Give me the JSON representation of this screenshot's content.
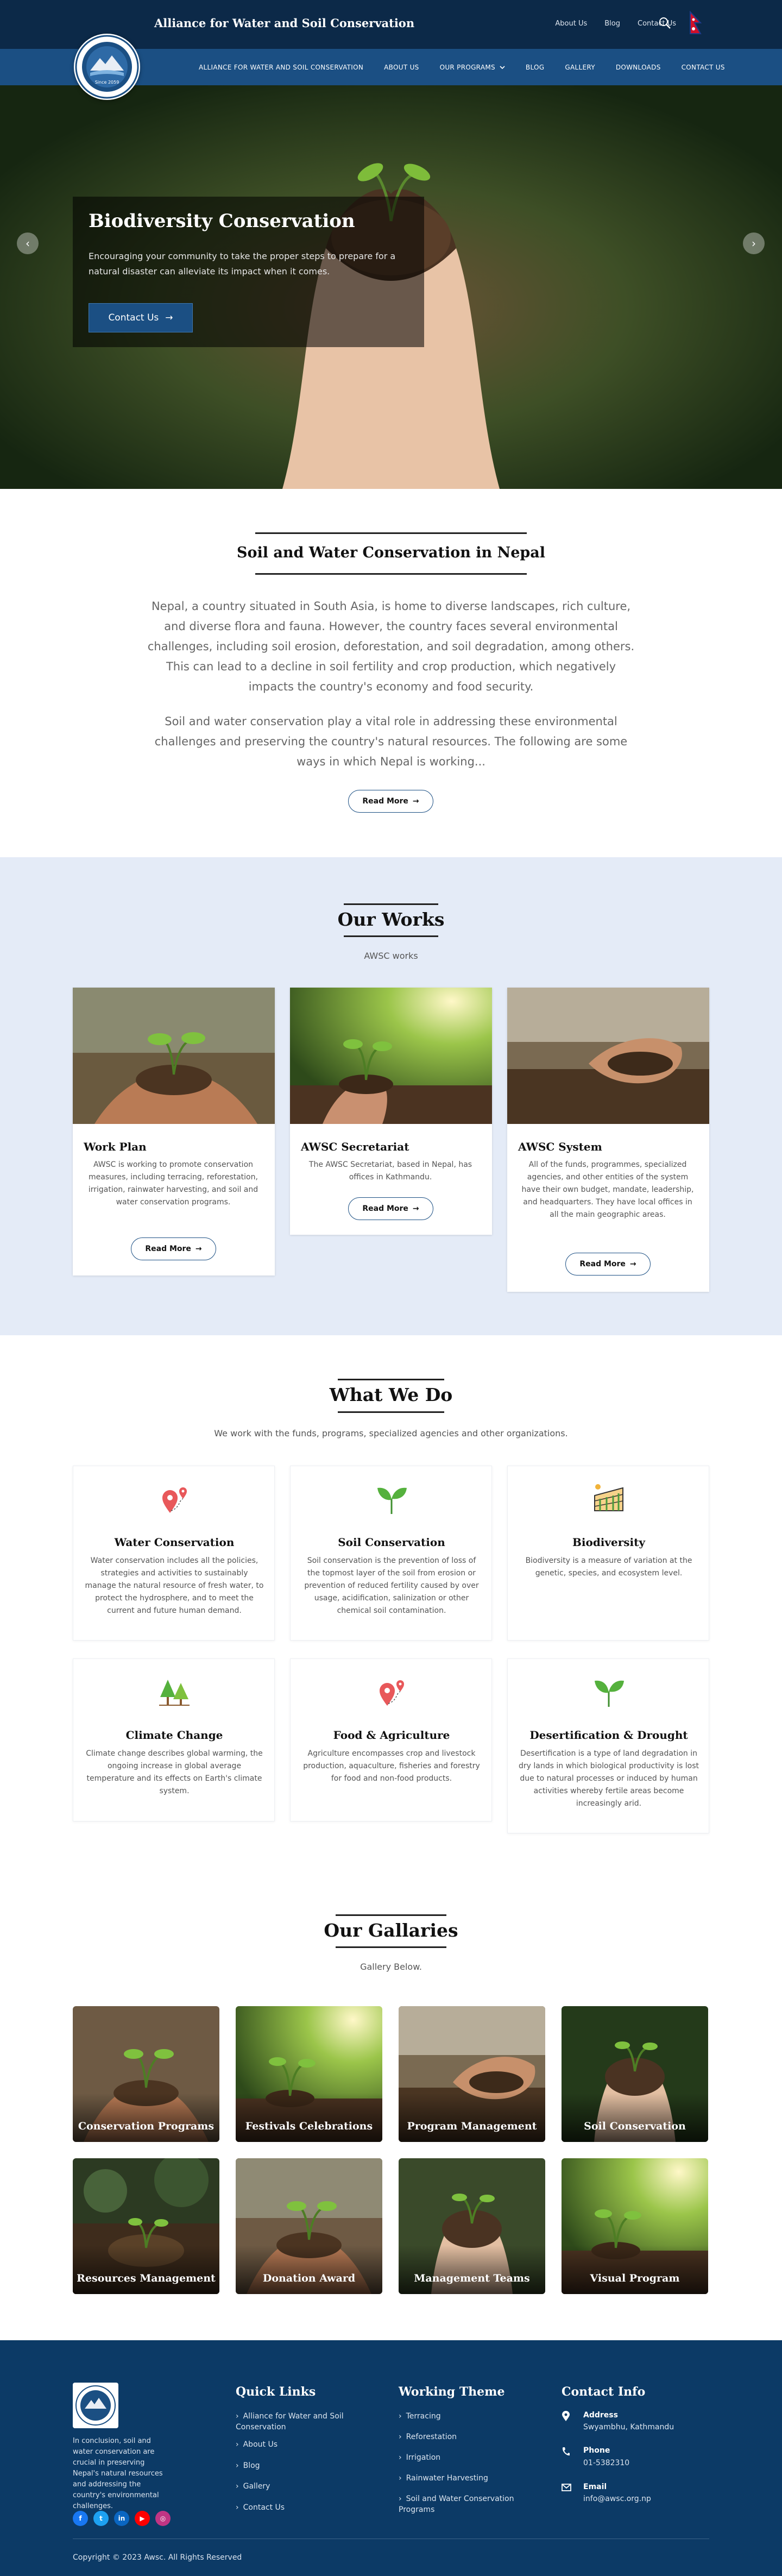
{
  "header": {
    "brand": "Alliance for Water and Soil Conservation",
    "top_links": [
      "About Us",
      "Blog",
      "Contact Us"
    ],
    "nav": [
      "ALLIANCE FOR WATER AND SOIL CONSERVATION",
      "ABOUT US",
      "OUR PROGRAMS",
      "BLOG",
      "GALLERY",
      "DOWNLOADS",
      "CONTACT US"
    ],
    "logo_text": "Since 2059"
  },
  "hero": {
    "title": "Biodiversity Conservation",
    "text": "Encouraging your community to take the proper steps to prepare for a natural disaster can alleviate its impact when it comes.",
    "button": "Contact Us",
    "arrow": "→",
    "prev": "‹",
    "next": "›"
  },
  "about": {
    "title": "Soil and Water Conservation in Nepal",
    "p1": "Nepal, a country situated in South Asia, is home to diverse landscapes, rich culture, and diverse flora and fauna. However, the country faces several environmental challenges, including soil erosion, deforestation, and soil degradation, among others. This can lead to a decline in soil fertility and crop production, which negatively impacts the country's economy and food security.",
    "p2": "Soil and water conservation play a vital role in addressing these environmental challenges and preserving the country's natural resources. The following are some ways in which Nepal is working...",
    "button": "Read More",
    "arrow": "→"
  },
  "works": {
    "title": "Our Works",
    "subtitle": "AWSC works",
    "button": "Read More",
    "arrow": "→",
    "cards": [
      {
        "title": "Work Plan",
        "text": "AWSC is working to promote conservation measures, including terracing, reforestation, irrigation, rainwater harvesting, and soil and water conservation programs."
      },
      {
        "title": "AWSC Secretariat",
        "text": "The AWSC Secretariat, based in Nepal, has offices in Kathmandu."
      },
      {
        "title": "AWSC System",
        "text": "All of the funds, programmes, specialized agencies, and other entities of the system have their own budget, mandate, leadership, and headquarters. They have local offices in all the main geographic areas."
      }
    ]
  },
  "whatwedo": {
    "title": "What We Do",
    "subtitle": "We work with the funds, programs, specialized agencies and other organizations.",
    "cards": [
      {
        "title": "Water Conservation",
        "text": "Water conservation includes all the policies, strategies and activities to sustainably manage the natural resource of fresh water, to protect the hydrosphere, and to meet the current and future human demand.",
        "icon": "map-pins-icon"
      },
      {
        "title": "Soil Conservation",
        "text": "Soil conservation is the prevention of loss of the topmost layer of the soil from erosion or prevention of reduced fertility caused by over usage, acidification, salinization or other chemical soil contamination.",
        "icon": "sprout-icon"
      },
      {
        "title": "Biodiversity",
        "text": "Biodiversity is a measure of variation at the genetic, species, and ecosystem level.",
        "icon": "field-icon"
      },
      {
        "title": "Climate Change",
        "text": "Climate change describes global warming, the ongoing increase in global average temperature and its effects on Earth's climate system.",
        "icon": "trees-icon"
      },
      {
        "title": "Food & Agriculture",
        "text": "Agriculture encompasses crop and livestock production, aquaculture, fisheries and forestry for food and non-food products.",
        "icon": "map-pins-icon"
      },
      {
        "title": "Desertification & Drought",
        "text": "Desertification is a type of land degradation in dry lands in which biological productivity is lost due to natural processes or induced by human activities whereby fertile areas become increasingly arid.",
        "icon": "sprout-icon"
      }
    ]
  },
  "gallery": {
    "title": "Our Gallaries",
    "subtitle": "Gallery Below.",
    "items": [
      "Conservation Programs",
      "Festivals Celebrations",
      "Program Management",
      "Soil Conservation",
      "Resources Management",
      "Donation Award",
      "Management Teams",
      "Visual Program"
    ]
  },
  "footer": {
    "about": "In conclusion, soil and water conservation are crucial in preserving Nepal's natural resources and addressing the country's environmental challenges.",
    "quick_title": "Quick Links",
    "quick_links": [
      "Alliance for Water and Soil Conservation",
      "About Us",
      "Blog",
      "Gallery",
      "Contact Us"
    ],
    "theme_title": "Working Theme",
    "theme_links": [
      "Terracing",
      "Reforestation",
      "Irrigation",
      "Rainwater Harvesting",
      "Soil and Water Conservation Programs"
    ],
    "contact_title": "Contact Info",
    "address_label": "Address",
    "address": "Swyambhu, Kathmandu",
    "phone_label": "Phone",
    "phone": "01-5382310",
    "email_label": "Email",
    "email": "info@awsc.org.np",
    "copyright": "Copyright © 2023 Awsc. All Rights Reserved",
    "bullet": "›",
    "social": [
      "f",
      "t",
      "in",
      "▶",
      "◎"
    ]
  },
  "colors": {
    "primary": "#1b4f83",
    "dark": "#0c2948",
    "footer": "#0c3a66",
    "works_bg": "#e4ebf7"
  }
}
